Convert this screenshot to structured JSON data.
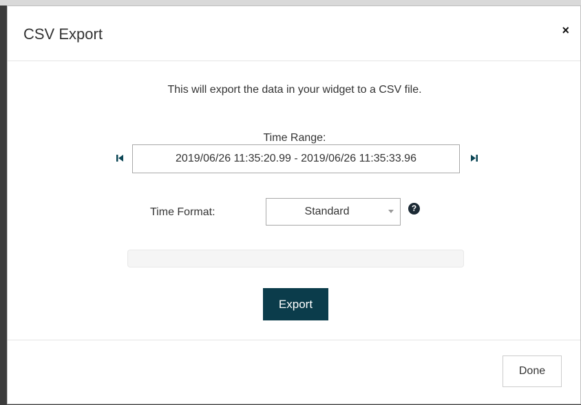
{
  "dialog": {
    "title": "CSV Export",
    "close_glyph": "×",
    "description": "This will export the data in your widget to a CSV file.",
    "time_range": {
      "label": "Time Range:",
      "value": "2019/06/26 11:35:20.99 - 2019/06/26 11:35:33.96",
      "first_icon": "skip-to-start-icon",
      "last_icon": "skip-to-end-icon"
    },
    "time_format": {
      "label": "Time Format:",
      "selected": "Standard",
      "help_glyph": "?"
    },
    "progress": {
      "value": 0
    },
    "export_label": "Export",
    "done_label": "Done"
  },
  "colors": {
    "primary_button": "#0b3c4b",
    "nav_icon": "#0b4655",
    "help_icon": "#1c2a35"
  }
}
